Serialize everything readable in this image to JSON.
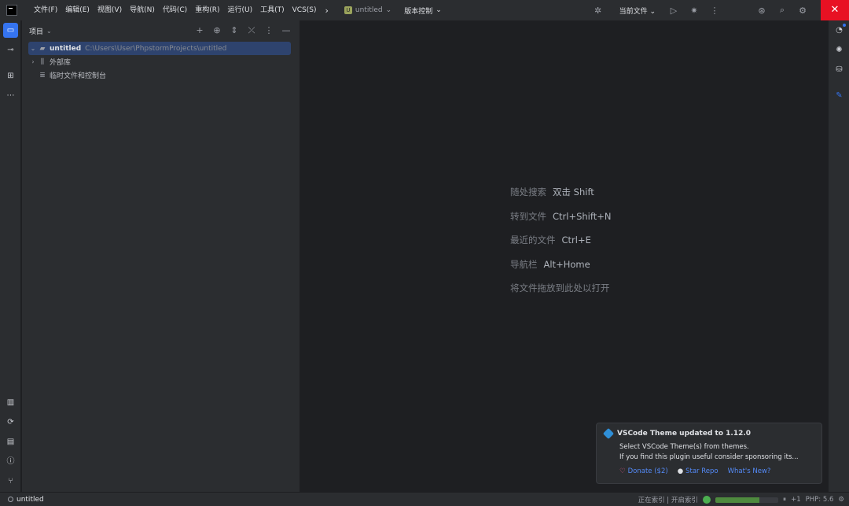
{
  "menubar": {
    "items": [
      "文件(F)",
      "编辑(E)",
      "视图(V)",
      "导航(N)",
      "代码(C)",
      "重构(R)",
      "运行(U)",
      "工具(T)",
      "VCS(S)"
    ],
    "more_icon": "chevron-right-icon"
  },
  "project_widget": {
    "badge": "U",
    "name": "untitled"
  },
  "vcs_widget": {
    "label": "版本控制"
  },
  "titlebar_right": {
    "current_file": "当前文件"
  },
  "project_panel": {
    "title": "项目",
    "tree": [
      {
        "name": "untitled",
        "path": "C:\\Users\\User\\PhpstormProjects\\untitled"
      },
      {
        "name": "外部库"
      },
      {
        "name": "临时文件和控制台"
      }
    ]
  },
  "editor": {
    "hints": [
      {
        "label": "随处搜索",
        "key": "双击 Shift"
      },
      {
        "label": "转到文件",
        "key": "Ctrl+Shift+N"
      },
      {
        "label": "最近的文件",
        "key": "Ctrl+E"
      },
      {
        "label": "导航栏",
        "key": "Alt+Home"
      },
      {
        "label": "将文件拖放到此处以打开",
        "key": ""
      }
    ]
  },
  "notification": {
    "title": "VSCode Theme updated to 1.12.0",
    "line1": "Select VSCode Theme(s) from themes.",
    "line2": "If you find this plugin useful consider sponsoring its...",
    "actions": {
      "donate": "Donate ($2)",
      "star": "Star Repo",
      "whats_new": "What's New?"
    }
  },
  "statusbar": {
    "project": "untitled",
    "task": "正在索引 | 开启索引",
    "progress": 0.7,
    "count": "+1",
    "php": "PHP: 5.6"
  },
  "colors": {
    "accent": "#3574f0",
    "close": "#e81123",
    "selection": "#2e436e"
  }
}
